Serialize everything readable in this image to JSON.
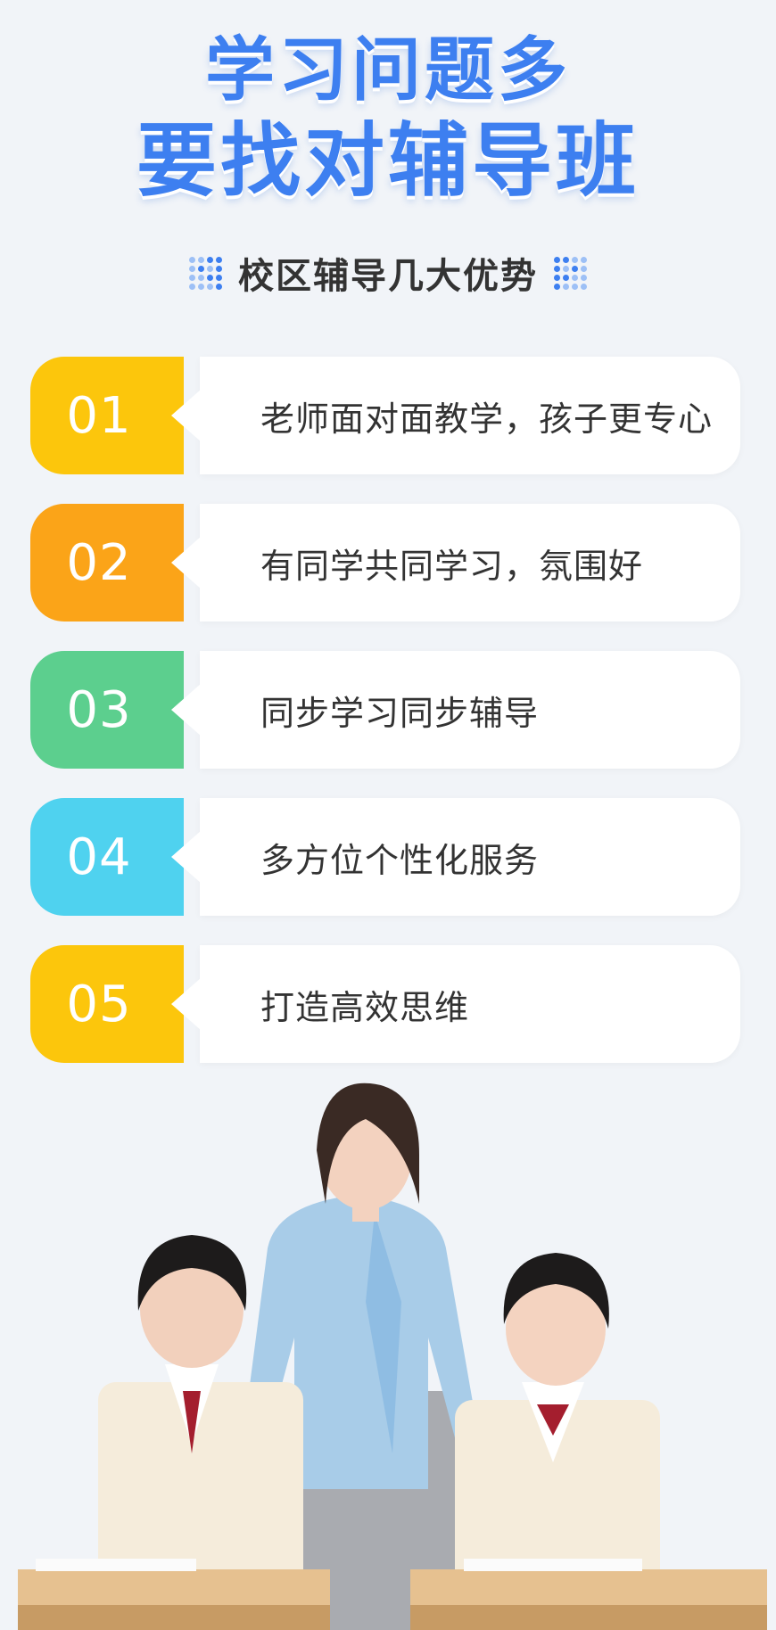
{
  "title": {
    "line1": "学习问题多",
    "line2": "要找对辅导班"
  },
  "subtitle": "校区辅导几大优势",
  "colors": {
    "accent": "#3d7ff0"
  },
  "advantages": [
    {
      "number": "01",
      "text": "老师面对面教学，孩子更专心",
      "color": "#fcc60c"
    },
    {
      "number": "02",
      "text": "有同学共同学习，氛围好",
      "color": "#fba418"
    },
    {
      "number": "03",
      "text": "同步学习同步辅导",
      "color": "#5ccf8e"
    },
    {
      "number": "04",
      "text": "多方位个性化服务",
      "color": "#4fd2ef"
    },
    {
      "number": "05",
      "text": "打造高效思维",
      "color": "#fcc60c"
    }
  ]
}
